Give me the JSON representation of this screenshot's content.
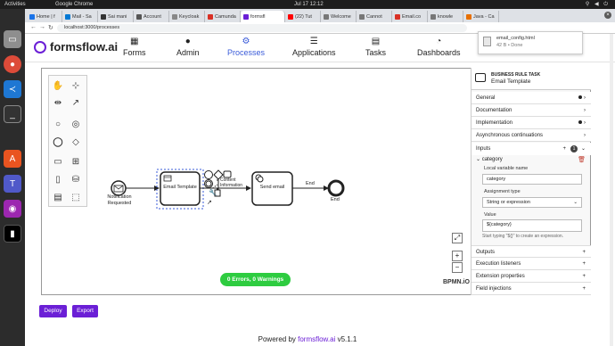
{
  "os": {
    "activities": "Activities",
    "app": "Google Chrome",
    "clock": "Jul 17  12:12"
  },
  "browser": {
    "tabs": [
      "Home | f",
      "Mail - Sa",
      "Sai mani",
      "Account",
      "Keycloak",
      "Camunda",
      "formsfl",
      "(22) Tut",
      "Welcome",
      "Cannot",
      "Email.co",
      "knowle",
      "Java - Ca"
    ],
    "url": "localhost:3000/processes"
  },
  "download": {
    "file": "email_config.html",
    "meta": "42 B • Done"
  },
  "app": {
    "brand": "formsflow.ai",
    "nav": [
      "Forms",
      "Admin",
      "Processes",
      "Applications",
      "Tasks",
      "Dashboards"
    ]
  },
  "diagram": {
    "start_label": "Notification Requested",
    "task1": "Email Template",
    "task2": "Send email",
    "flow_label": "End",
    "end_label": "End",
    "annotation": "Content Information",
    "status": "0 Errors, 0 Warnings",
    "bpmnio": "BPMN.iO"
  },
  "properties": {
    "type": "BUSINESS RULE TASK",
    "name": "Email Template",
    "groups": [
      "General",
      "Documentation",
      "Implementation",
      "Asynchronous continuations",
      "Inputs"
    ],
    "inputs_count": "1",
    "input_name": "category",
    "local_var_label": "Local variable name",
    "local_var": "category",
    "assign_label": "Assignment type",
    "assign": "String or expression",
    "value_label": "Value",
    "value": "${category}",
    "hint": "Start typing \"${}\" to create an expression.",
    "groups_after": [
      "Outputs",
      "Execution listeners",
      "Extension properties",
      "Field injections"
    ]
  },
  "buttons": {
    "deploy": "Deploy",
    "export": "Export"
  },
  "footer": {
    "prefix": "Powered by ",
    "brand": "formsflow.ai",
    "version": " v5.1.1"
  },
  "colors": {
    "brand": "#6b1fd6",
    "active": "#3a5bd9",
    "ok": "#2ecc40"
  }
}
